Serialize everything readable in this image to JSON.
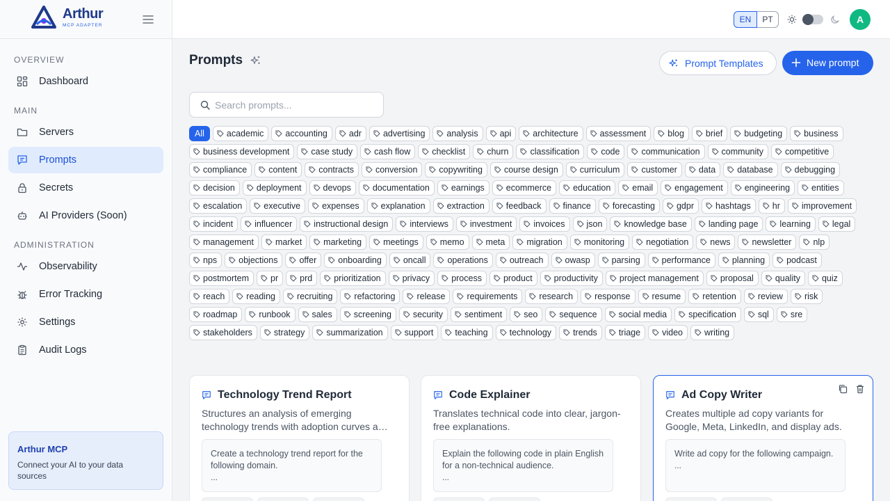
{
  "brand": {
    "name": "Arthur",
    "subtitle": "MCP ADAPTER"
  },
  "sidebar": {
    "sections": [
      {
        "title": "OVERVIEW",
        "items": [
          {
            "label": "Dashboard",
            "icon": "dashboard-icon"
          }
        ]
      },
      {
        "title": "MAIN",
        "items": [
          {
            "label": "Servers",
            "icon": "folder-icon"
          },
          {
            "label": "Prompts",
            "icon": "message-icon",
            "active": true
          },
          {
            "label": "Secrets",
            "icon": "lock-icon"
          },
          {
            "label": "AI Providers (Soon)",
            "icon": "robot-icon"
          }
        ]
      },
      {
        "title": "ADMINISTRATION",
        "items": [
          {
            "label": "Observability",
            "icon": "activity-icon"
          },
          {
            "label": "Error Tracking",
            "icon": "bug-icon"
          },
          {
            "label": "Settings",
            "icon": "gear-icon"
          },
          {
            "label": "Audit Logs",
            "icon": "clipboard-icon"
          }
        ]
      }
    ],
    "promo": {
      "title": "Arthur MCP",
      "description": "Connect your AI to your data sources"
    }
  },
  "topbar": {
    "lang_en": "EN",
    "lang_pt": "PT",
    "avatar_initial": "A",
    "accent": "#2563eb",
    "avatar_color": "#10b981"
  },
  "main": {
    "title": "Prompts",
    "templates_button": "Prompt Templates",
    "new_button": "New prompt",
    "search_placeholder": "Search prompts...",
    "all_tag": "All",
    "tags": [
      "academic",
      "accounting",
      "adr",
      "advertising",
      "analysis",
      "api",
      "architecture",
      "assessment",
      "blog",
      "brief",
      "budgeting",
      "business",
      "business development",
      "case study",
      "cash flow",
      "checklist",
      "churn",
      "classification",
      "code",
      "communication",
      "community",
      "competitive",
      "compliance",
      "content",
      "contracts",
      "conversion",
      "copywriting",
      "course design",
      "curriculum",
      "customer",
      "data",
      "database",
      "debugging",
      "decision",
      "deployment",
      "devops",
      "documentation",
      "earnings",
      "ecommerce",
      "education",
      "email",
      "engagement",
      "engineering",
      "entities",
      "escalation",
      "executive",
      "expenses",
      "explanation",
      "extraction",
      "feedback",
      "finance",
      "forecasting",
      "gdpr",
      "hashtags",
      "hr",
      "improvement",
      "incident",
      "influencer",
      "instructional design",
      "interviews",
      "investment",
      "invoices",
      "json",
      "knowledge base",
      "landing page",
      "learning",
      "legal",
      "management",
      "market",
      "marketing",
      "meetings",
      "memo",
      "meta",
      "migration",
      "monitoring",
      "negotiation",
      "news",
      "newsletter",
      "nlp",
      "nps",
      "objections",
      "offer",
      "onboarding",
      "oncall",
      "operations",
      "outreach",
      "owasp",
      "parsing",
      "performance",
      "planning",
      "podcast",
      "postmortem",
      "pr",
      "prd",
      "prioritization",
      "privacy",
      "process",
      "product",
      "productivity",
      "project management",
      "proposal",
      "quality",
      "quiz",
      "reach",
      "reading",
      "recruiting",
      "refactoring",
      "release",
      "requirements",
      "research",
      "response",
      "resume",
      "retention",
      "review",
      "risk",
      "roadmap",
      "runbook",
      "sales",
      "screening",
      "security",
      "sentiment",
      "seo",
      "sequence",
      "social media",
      "specification",
      "sql",
      "sre",
      "stakeholders",
      "strategy",
      "summarization",
      "support",
      "teaching",
      "technology",
      "trends",
      "triage",
      "video",
      "writing"
    ],
    "cards": [
      {
        "title": "Technology Trend Report",
        "description": "Structures an analysis of emerging technology trends with adoption curves and implications.",
        "preview": "Create a technology trend report for the following domain.",
        "ellipsis": "..."
      },
      {
        "title": "Code Explainer",
        "description": "Translates technical code into clear, jargon-free explanations.",
        "preview": "Explain the following code in plain English for a non-technical audience.",
        "ellipsis": "..."
      },
      {
        "title": "Ad Copy Writer",
        "description": "Creates multiple ad copy variants for Google, Meta, LinkedIn, and display ads.",
        "preview": "Write ad copy for the following campaign.",
        "ellipsis": "..."
      }
    ]
  }
}
